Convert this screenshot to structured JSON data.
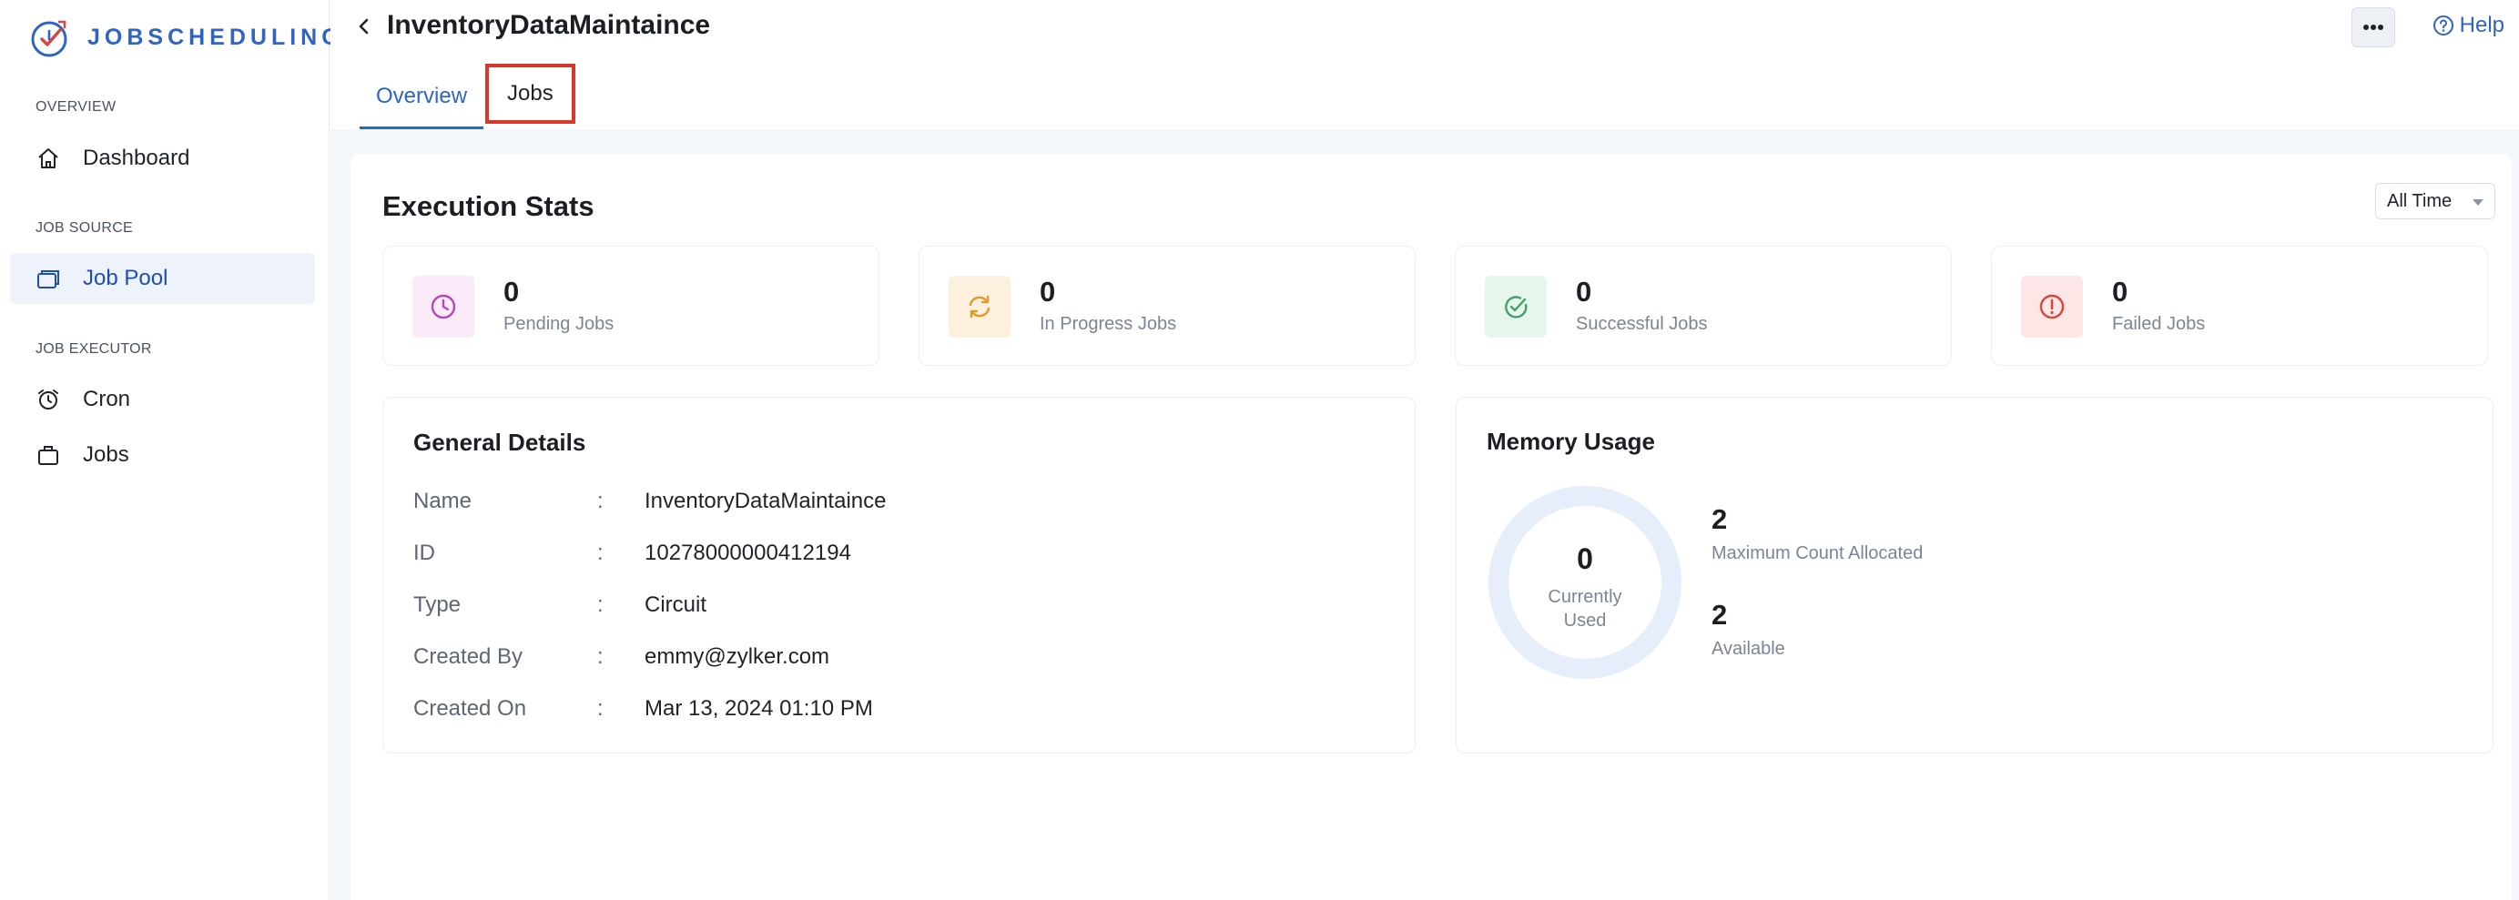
{
  "brand": {
    "name": "JOBSCHEDULING"
  },
  "sidebar": {
    "sections": [
      {
        "label": "OVERVIEW"
      },
      {
        "label": "JOB SOURCE"
      },
      {
        "label": "JOB EXECUTOR"
      }
    ],
    "items": [
      {
        "label": "Dashboard",
        "icon": "home-icon"
      },
      {
        "label": "Job Pool",
        "icon": "job-pool-icon",
        "active": true
      },
      {
        "label": "Cron",
        "icon": "alarm-clock-icon"
      },
      {
        "label": "Jobs",
        "icon": "briefcase-icon"
      }
    ]
  },
  "header": {
    "title": "InventoryDataMaintaince",
    "help_label": "Help",
    "tabs": [
      {
        "label": "Overview",
        "active": true
      },
      {
        "label": "Jobs",
        "active": false
      }
    ]
  },
  "execution_stats": {
    "title": "Execution Stats",
    "range": "All Time",
    "cards": [
      {
        "value": "0",
        "label": "Pending Jobs",
        "icon": "clock-icon",
        "icon_color": "#b348b8",
        "bg": "#fbeaf7"
      },
      {
        "value": "0",
        "label": "In Progress Jobs",
        "icon": "refresh-icon",
        "icon_color": "#e29a2b",
        "bg": "#fdf1de"
      },
      {
        "value": "0",
        "label": "Successful Jobs",
        "icon": "check-circle-icon",
        "icon_color": "#3fa268",
        "bg": "#e6f6ec"
      },
      {
        "value": "0",
        "label": "Failed Jobs",
        "icon": "alert-circle-icon",
        "icon_color": "#d6463a",
        "bg": "#fde7e6"
      }
    ]
  },
  "general_details": {
    "title": "General Details",
    "rows": [
      {
        "key": "Name",
        "value": "InventoryDataMaintaince"
      },
      {
        "key": "ID",
        "value": "10278000000412194"
      },
      {
        "key": "Type",
        "value": "Circuit"
      },
      {
        "key": "Created By",
        "value": "emmy@zylker.com"
      },
      {
        "key": "Created On",
        "value": "Mar 13, 2024 01:10 PM"
      }
    ]
  },
  "memory_usage": {
    "title": "Memory Usage",
    "currently_used_value": "0",
    "currently_used_label": "Currently Used",
    "maximum_value": "2",
    "maximum_label": "Maximum Count Allocated",
    "available_value": "2",
    "available_label": "Available",
    "used_fraction": 0
  },
  "colors": {
    "accent": "#2f64c4",
    "highlight_outline": "#d6382b"
  }
}
